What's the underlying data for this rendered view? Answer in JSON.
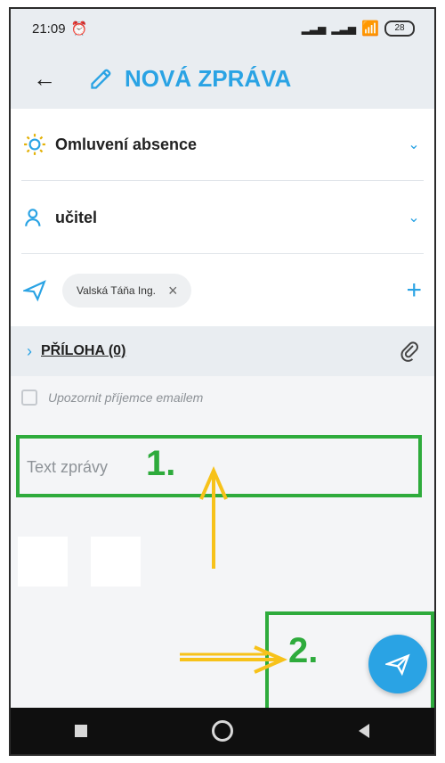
{
  "status": {
    "time": "21:09",
    "battery": "28"
  },
  "header": {
    "title": "NOVÁ ZPRÁVA"
  },
  "form": {
    "category": "Omluvení absence",
    "recipient_type": "učitel",
    "recipient_chip": "Valská Táňa Ing.",
    "attachments_label": "PŘÍLOHA (0)",
    "notify_label": "Upozornit příjemce emailem",
    "message_placeholder": "Text zprávy"
  },
  "annotations": {
    "step1": "1.",
    "step2": "2.",
    "color_green": "#2eab3c",
    "color_arrow": "#f7c21a"
  },
  "colors": {
    "accent": "#2aa3e4"
  }
}
